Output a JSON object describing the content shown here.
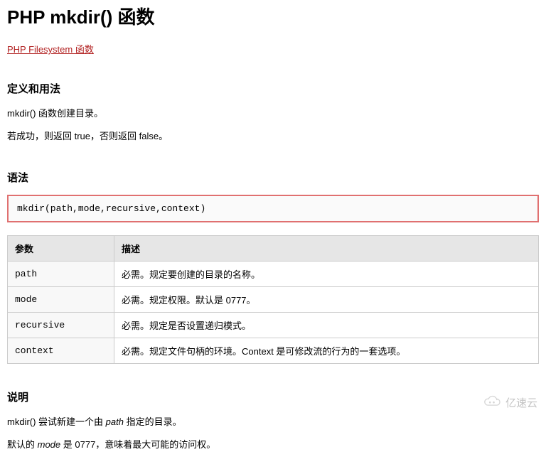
{
  "page": {
    "title": "PHP mkdir() 函数",
    "nav_link": "PHP Filesystem 函数"
  },
  "s1": {
    "heading": "定义和用法",
    "p1": "mkdir() 函数创建目录。",
    "p2": "若成功，则返回 true，否则返回 false。"
  },
  "s2": {
    "heading": "语法",
    "code": "mkdir(path,mode,recursive,context)"
  },
  "table": {
    "head": {
      "param": "参数",
      "desc": "描述"
    },
    "rows": [
      {
        "param": "path",
        "desc": "必需。规定要创建的目录的名称。"
      },
      {
        "param": "mode",
        "desc": "必需。规定权限。默认是 0777。"
      },
      {
        "param": "recursive",
        "desc": "必需。规定是否设置递归模式。"
      },
      {
        "param": "context",
        "desc": "必需。规定文件句柄的环境。Context 是可修改流的行为的一套选项。"
      }
    ]
  },
  "s3": {
    "heading": "说明",
    "p1a": "mkdir() 尝试新建一个由 ",
    "p1i": "path",
    "p1b": " 指定的目录。",
    "p2a": "默认的 ",
    "p2i": "mode",
    "p2b": " 是 0777，意味着最大可能的访问权。"
  },
  "watermark": "亿速云"
}
